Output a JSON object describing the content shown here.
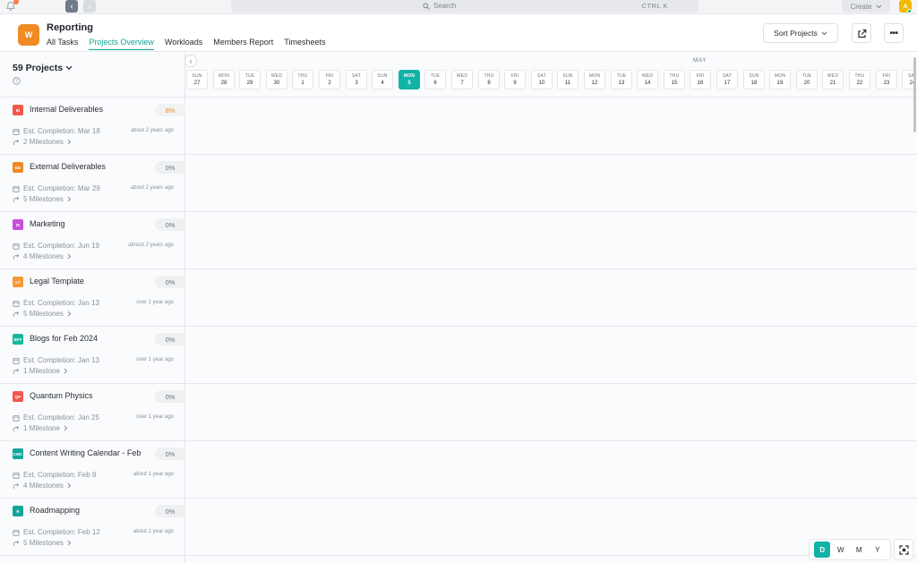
{
  "topbar": {
    "search_placeholder": "Search",
    "search_shortcut": "CTRL K",
    "create_label": "Create",
    "avatar_initial": "A"
  },
  "header": {
    "logo_letter": "W",
    "title": "Reporting",
    "tabs": [
      {
        "label": "All Tasks"
      },
      {
        "label": "Projects Overview"
      },
      {
        "label": "Workloads"
      },
      {
        "label": "Members Report"
      },
      {
        "label": "Timesheets"
      }
    ],
    "sort_label": "Sort Projects"
  },
  "sidebar": {
    "count_label": "59 Projects"
  },
  "projects": [
    {
      "badge": "ID",
      "color": "#f2574c",
      "name": "Internal Deliverables",
      "pct": "8%",
      "est": "Est. Completion: Mar 18",
      "ago": "about 2 years ago",
      "milestones": "2 Milestones"
    },
    {
      "badge": "ED",
      "color": "#f08a24",
      "name": "External Deliverables",
      "pct": "0%",
      "est": "Est. Completion: Mar 29",
      "ago": "about 2 years ago",
      "milestones": "5 Milestones"
    },
    {
      "badge": "M",
      "color": "#c54fd8",
      "name": "Marketing",
      "pct": "0%",
      "est": "Est. Completion: Jun 19",
      "ago": "almost 2 years ago",
      "milestones": "4 Milestones"
    },
    {
      "badge": "LT",
      "color": "#f59a3c",
      "name": "Legal Template",
      "pct": "0%",
      "est": "Est. Completion: Jan 13",
      "ago": "over 1 year ago",
      "milestones": "5 Milestones"
    },
    {
      "badge": "BFF",
      "color": "#14b89c",
      "name": "Blogs for Feb 2024",
      "pct": "0%",
      "est": "Est. Completion: Jan 13",
      "ago": "over 1 year ago",
      "milestones": "1 Milestone"
    },
    {
      "badge": "QP",
      "color": "#f2574c",
      "name": "Quantum Physics",
      "pct": "0%",
      "est": "Est. Completion: Jan 25",
      "ago": "over 1 year ago",
      "milestones": "1 Milestone"
    },
    {
      "badge": "CWC",
      "color": "#11a69a",
      "name": "Content Writing Calendar - Feb",
      "pct": "0%",
      "est": "Est. Completion: Feb 8",
      "ago": "about 1 year ago",
      "milestones": "4 Milestones"
    },
    {
      "badge": "R",
      "color": "#11a69a",
      "name": "Roadmapping",
      "pct": "0%",
      "est": "Est. Completion: Feb 12",
      "ago": "about 1 year ago",
      "milestones": "5 Milestones"
    }
  ],
  "timeline": {
    "month": "MAY",
    "days": [
      {
        "dn": "SUN",
        "dd": "27"
      },
      {
        "dn": "MON",
        "dd": "28"
      },
      {
        "dn": "TUE",
        "dd": "29"
      },
      {
        "dn": "WED",
        "dd": "30"
      },
      {
        "dn": "THU",
        "dd": "1"
      },
      {
        "dn": "FRI",
        "dd": "2"
      },
      {
        "dn": "SAT",
        "dd": "3"
      },
      {
        "dn": "SUN",
        "dd": "4"
      },
      {
        "dn": "MON",
        "dd": "5",
        "today": true
      },
      {
        "dn": "TUE",
        "dd": "6"
      },
      {
        "dn": "WED",
        "dd": "7"
      },
      {
        "dn": "THU",
        "dd": "8"
      },
      {
        "dn": "FRI",
        "dd": "9"
      },
      {
        "dn": "SAT",
        "dd": "10"
      },
      {
        "dn": "SUN",
        "dd": "11"
      },
      {
        "dn": "MON",
        "dd": "12"
      },
      {
        "dn": "TUE",
        "dd": "13"
      },
      {
        "dn": "WED",
        "dd": "14"
      },
      {
        "dn": "THU",
        "dd": "15"
      },
      {
        "dn": "FRI",
        "dd": "16"
      },
      {
        "dn": "SAT",
        "dd": "17"
      },
      {
        "dn": "SUN",
        "dd": "18"
      },
      {
        "dn": "MON",
        "dd": "19"
      },
      {
        "dn": "TUE",
        "dd": "20"
      },
      {
        "dn": "WED",
        "dd": "21"
      },
      {
        "dn": "THU",
        "dd": "22"
      },
      {
        "dn": "FRI",
        "dd": "23"
      },
      {
        "dn": "SAT",
        "dd": "24"
      }
    ]
  },
  "zoom": {
    "options": [
      "D",
      "W",
      "M",
      "Y"
    ],
    "active": "D"
  }
}
